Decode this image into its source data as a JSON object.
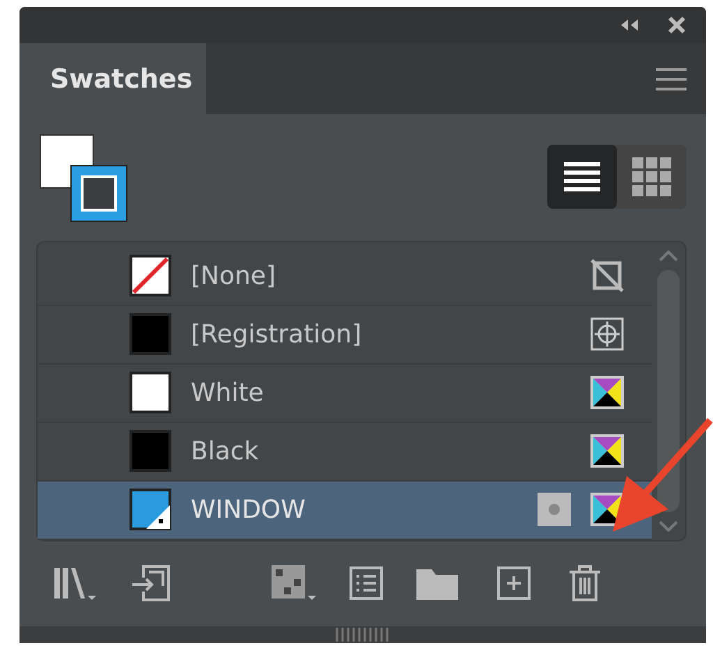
{
  "panel": {
    "tabs": [
      {
        "label": "Swatches",
        "selected": true
      }
    ]
  },
  "view": {
    "list_selected": true,
    "grid_selected": false
  },
  "swatches": [
    {
      "name": "[None]",
      "kind": "none",
      "selected": false,
      "type_icon": {
        "kind": "noedit"
      }
    },
    {
      "name": "[Registration]",
      "kind": "registration",
      "selected": false,
      "type_icon": {
        "kind": "registration"
      }
    },
    {
      "name": "White",
      "kind": "white",
      "selected": false,
      "type_icon": {
        "kind": "cmyk"
      }
    },
    {
      "name": "Black",
      "kind": "black",
      "selected": false,
      "type_icon": {
        "kind": "cmyk"
      }
    },
    {
      "name": "WINDOW",
      "kind": "tint",
      "color": "#2b9be0",
      "selected": true,
      "type_icon": {
        "kind": "cmyk"
      },
      "spot": true
    }
  ]
}
